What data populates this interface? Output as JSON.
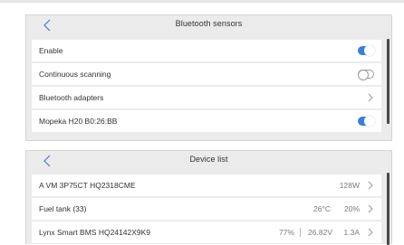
{
  "bluetooth_sensors": {
    "title": "Bluetooth sensors",
    "rows": [
      {
        "label": "Enable",
        "control": "toggle",
        "state": "on"
      },
      {
        "label": "Continuous scanning",
        "control": "toggle",
        "state": "off"
      },
      {
        "label": "Bluetooth adapters",
        "control": "chevron"
      },
      {
        "label": "Mopeka H20 B0:26:BB",
        "control": "toggle",
        "state": "on"
      }
    ]
  },
  "device_list": {
    "title": "Device list",
    "rows": [
      {
        "label": "A VM 3P75CT HQ2318CME",
        "values": [
          "128W"
        ]
      },
      {
        "label": "Fuel tank (33)",
        "values": [
          "26°C",
          "20%"
        ]
      },
      {
        "label": "Lynx Smart BMS HQ24142X9K9",
        "values": [
          "77%",
          "26.82V",
          "1.3A"
        ]
      }
    ]
  },
  "colors": {
    "accent": "#3a7fd8",
    "panel_bg": "#ebebeb",
    "row_bg": "#ffffff"
  },
  "icons": {
    "back": "chevron-left-icon",
    "row_nav": "chevron-right-icon"
  }
}
